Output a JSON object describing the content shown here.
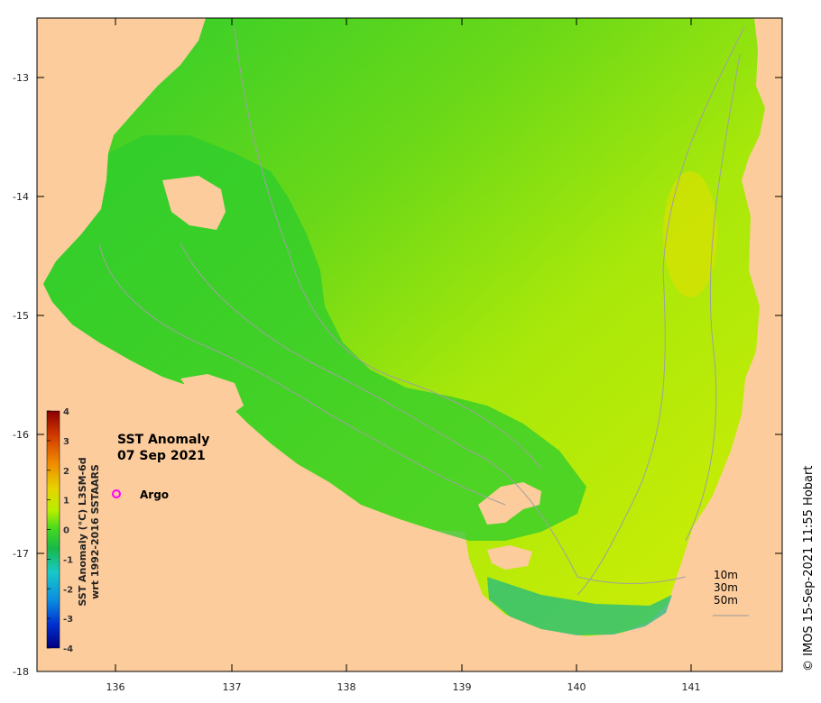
{
  "title": {
    "line1": "SST Anomaly",
    "line2": "07 Sep 2021"
  },
  "legend": {
    "argo_label": "Argo",
    "argo_color": "#ff00ff"
  },
  "colorbar": {
    "label_line1": "SST Anomaly (°C) L3SM-6d",
    "label_line2": "wrt 1992-2016 SSTAARS",
    "ticks": [
      "4",
      "3",
      "2",
      "1",
      "0",
      "-1",
      "-2",
      "-3",
      "-4"
    ],
    "colors": [
      "#00007f",
      "#0030d0",
      "#0a8ce0",
      "#18c8c8",
      "#18b84a",
      "#42d820",
      "#b8ee00",
      "#e6d400",
      "#f08a00",
      "#d03800",
      "#8a0000"
    ]
  },
  "depth_legend": {
    "items": [
      "10m",
      "30m",
      "50m"
    ]
  },
  "axes": {
    "lon_labels": [
      "136",
      "137",
      "138",
      "139",
      "140",
      "141"
    ],
    "lat_labels": [
      "-13",
      "-14",
      "-15",
      "-16",
      "-17",
      "-18"
    ]
  },
  "credit": "© IMOS 15-Sep-2021 11:55 Hobart",
  "colors": {
    "land": "#fccc9c",
    "sea_main": "#90e610",
    "sea_cool": "#2ccc2e",
    "sea_warm": "#d2ee04",
    "sea_cold": "#14b88a",
    "contour": "#a0a0a0",
    "frame": "#000000"
  }
}
